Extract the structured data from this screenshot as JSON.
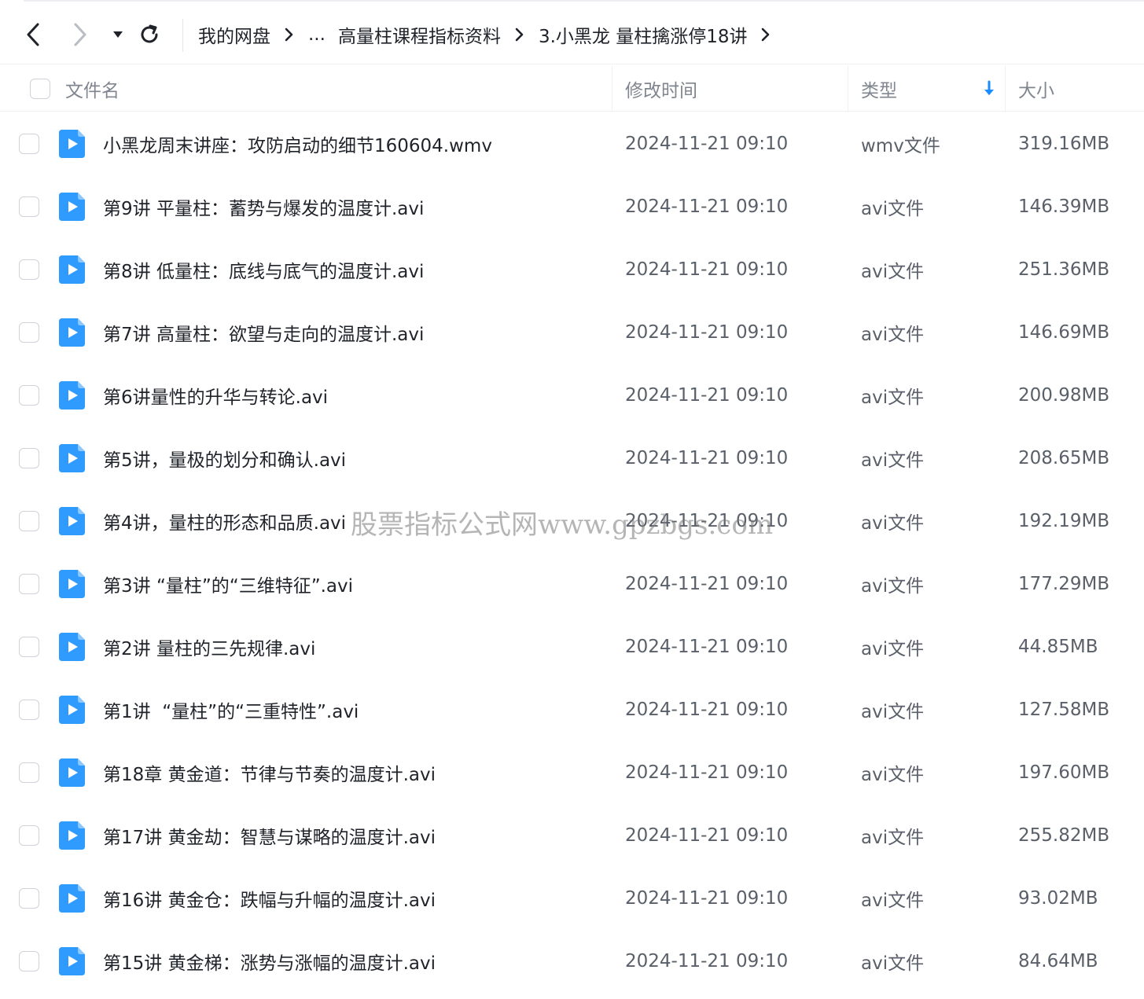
{
  "toolbar": {
    "back_icon": "chevron-left-icon",
    "forward_icon": "chevron-right-icon",
    "dropdown_icon": "caret-down-icon",
    "refresh_icon": "refresh-icon",
    "breadcrumbs": [
      "我的网盘",
      "...",
      "高量柱课程指标资料",
      "3.小黑龙 量柱擒涨停18讲"
    ]
  },
  "table": {
    "columns": {
      "name": "文件名",
      "modified": "修改时间",
      "type": "类型",
      "size": "大小"
    },
    "sort_icon": "sort-down-arrow-icon",
    "rows": [
      {
        "name": "小黑龙周末讲座：攻防启动的细节160604.wmv",
        "modified": "2024-11-21 09:10",
        "type": "wmv文件",
        "size": "319.16MB"
      },
      {
        "name": "第9讲 平量柱：蓄势与爆发的温度计.avi",
        "modified": "2024-11-21 09:10",
        "type": "avi文件",
        "size": "146.39MB"
      },
      {
        "name": "第8讲 低量柱：底线与底气的温度计.avi",
        "modified": "2024-11-21 09:10",
        "type": "avi文件",
        "size": "251.36MB"
      },
      {
        "name": "第7讲 高量柱：欲望与走向的温度计.avi",
        "modified": "2024-11-21 09:10",
        "type": "avi文件",
        "size": "146.69MB"
      },
      {
        "name": "第6讲量性的升华与转论.avi",
        "modified": "2024-11-21 09:10",
        "type": "avi文件",
        "size": "200.98MB"
      },
      {
        "name": "第5讲，量极的划分和确认.avi",
        "modified": "2024-11-21 09:10",
        "type": "avi文件",
        "size": "208.65MB"
      },
      {
        "name": "第4讲，量柱的形态和品质.avi",
        "modified": "2024-11-21 09:10",
        "type": "avi文件",
        "size": "192.19MB"
      },
      {
        "name": "第3讲 “量柱”的“三维特征”.avi",
        "modified": "2024-11-21 09:10",
        "type": "avi文件",
        "size": "177.29MB"
      },
      {
        "name": "第2讲 量柱的三先规律.avi",
        "modified": "2024-11-21 09:10",
        "type": "avi文件",
        "size": "44.85MB"
      },
      {
        "name": "第1讲  “量柱”的“三重特性”.avi",
        "modified": "2024-11-21 09:10",
        "type": "avi文件",
        "size": "127.58MB"
      },
      {
        "name": "第18章 黄金道：节律与节奏的温度计.avi",
        "modified": "2024-11-21 09:10",
        "type": "avi文件",
        "size": "197.60MB"
      },
      {
        "name": "第17讲 黄金劫：智慧与谋略的温度计.avi",
        "modified": "2024-11-21 09:10",
        "type": "avi文件",
        "size": "255.82MB"
      },
      {
        "name": "第16讲 黄金仓：跌幅与升幅的温度计.avi",
        "modified": "2024-11-21 09:10",
        "type": "avi文件",
        "size": "93.02MB"
      },
      {
        "name": "第15讲 黄金梯：涨势与涨幅的温度计.avi",
        "modified": "2024-11-21 09:10",
        "type": "avi文件",
        "size": "84.64MB"
      }
    ],
    "file_icon": "video-file-icon"
  },
  "watermark": "股票指标公式网www.gpzbgs.com",
  "colors": {
    "accent": "#1a8cff",
    "file_icon": "#2f9bff",
    "text": "#1f2329",
    "muted": "#80868f"
  }
}
